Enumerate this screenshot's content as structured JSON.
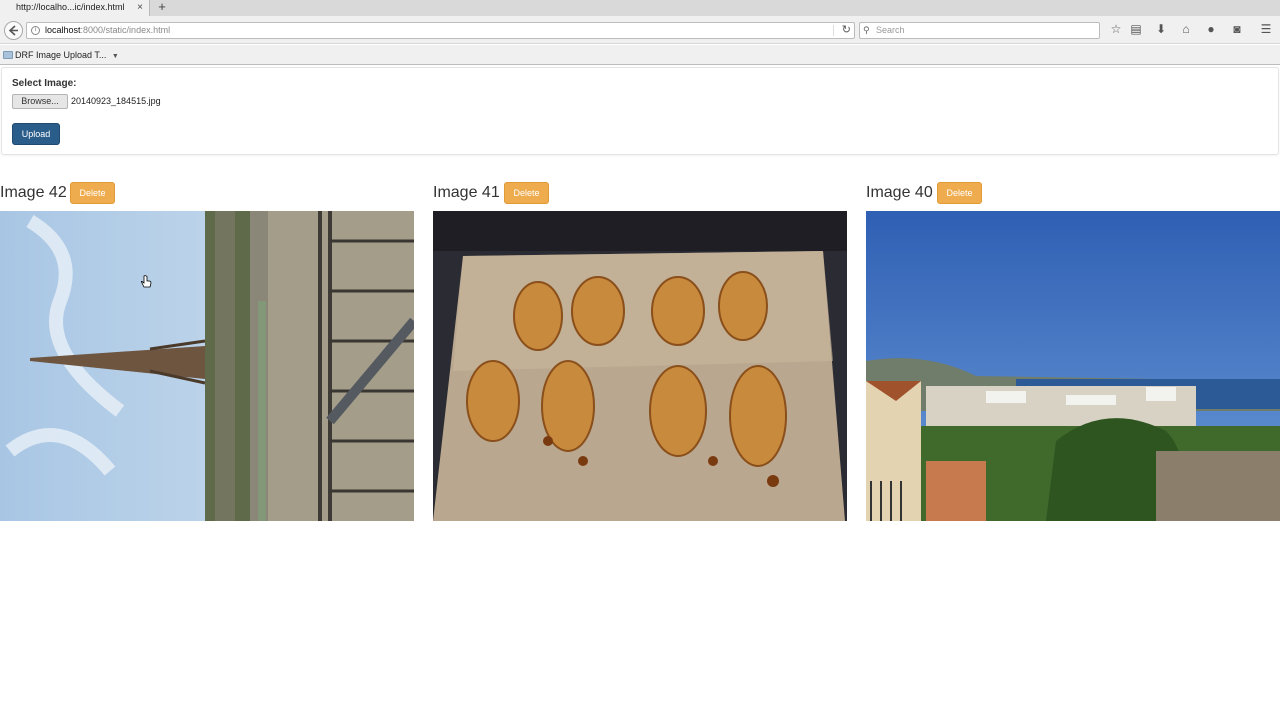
{
  "browser": {
    "tab_title": "http://localho...ic/index.html",
    "tab_close": "×",
    "new_tab": "+",
    "url_host": "localhost",
    "url_path": ":8000/static/index.html",
    "search_placeholder": "Search",
    "bookmark_label": "DRF Image Upload T...",
    "icons": [
      "back-icon",
      "info-icon",
      "reload-icon",
      "search-icon",
      "star-icon",
      "reading-list-icon",
      "download-icon",
      "home-icon",
      "chat-icon",
      "pocket-icon",
      "menu-icon"
    ]
  },
  "upload": {
    "label": "Select Image:",
    "browse_label": "Browse...",
    "filename": "20140923_184515.jpg",
    "upload_label": "Upload"
  },
  "images": [
    {
      "title": "Image 42",
      "delete_label": "Delete",
      "subject": "eiffel-tower-photo"
    },
    {
      "title": "Image 41",
      "delete_label": "Delete",
      "subject": "croissants-photo"
    },
    {
      "title": "Image 40",
      "delete_label": "Delete",
      "subject": "coastal-town-photo"
    }
  ],
  "colors": {
    "upload_button": "#2a5d8a",
    "delete_button": "#efac4e"
  }
}
